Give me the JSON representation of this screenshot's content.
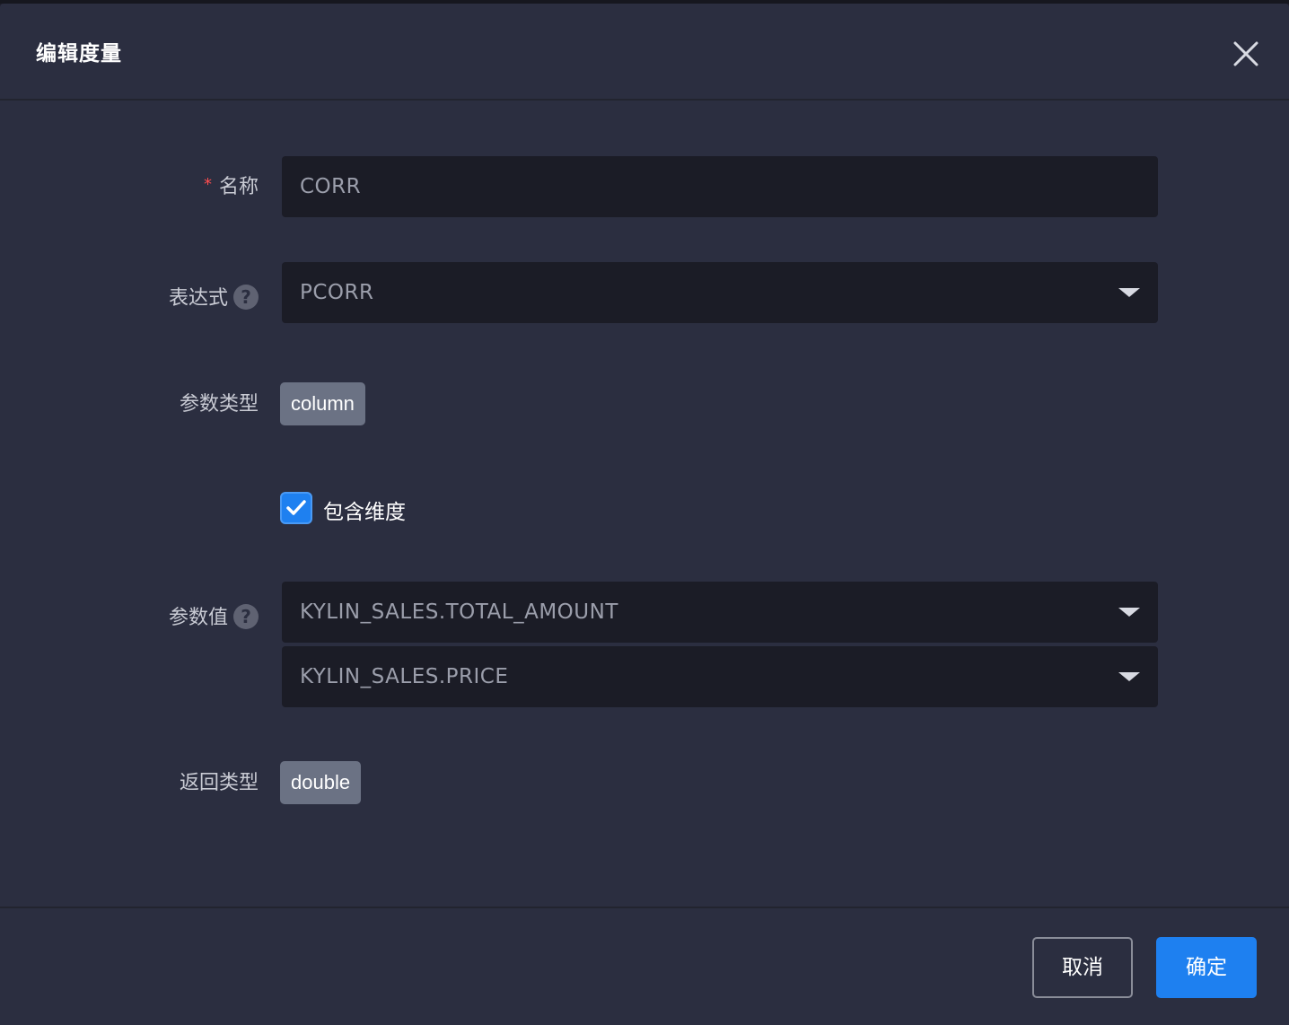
{
  "dialog": {
    "title": "编辑度量"
  },
  "form": {
    "name": {
      "label": "名称",
      "required_mark": "*",
      "value": "CORR"
    },
    "expression": {
      "label": "表达式",
      "help": "?",
      "value": "PCORR"
    },
    "param_type": {
      "label": "参数类型",
      "value": "column"
    },
    "include_dimension": {
      "label": "包含维度",
      "checked": true
    },
    "param_value": {
      "label": "参数值",
      "help": "?",
      "values": [
        "KYLIN_SALES.TOTAL_AMOUNT",
        "KYLIN_SALES.PRICE"
      ]
    },
    "return_type": {
      "label": "返回类型",
      "value": "double"
    }
  },
  "footer": {
    "cancel_label": "取消",
    "confirm_label": "确定"
  },
  "colors": {
    "primary": "#1e80f0",
    "dialog_bg": "#2b2e40",
    "input_bg": "#1b1c26",
    "tag_bg": "#6b7284",
    "required": "#ff4d4f"
  },
  "icons": {
    "close": "close-icon",
    "help": "question-circle-icon",
    "caret": "caret-down-icon",
    "check": "check-icon"
  }
}
